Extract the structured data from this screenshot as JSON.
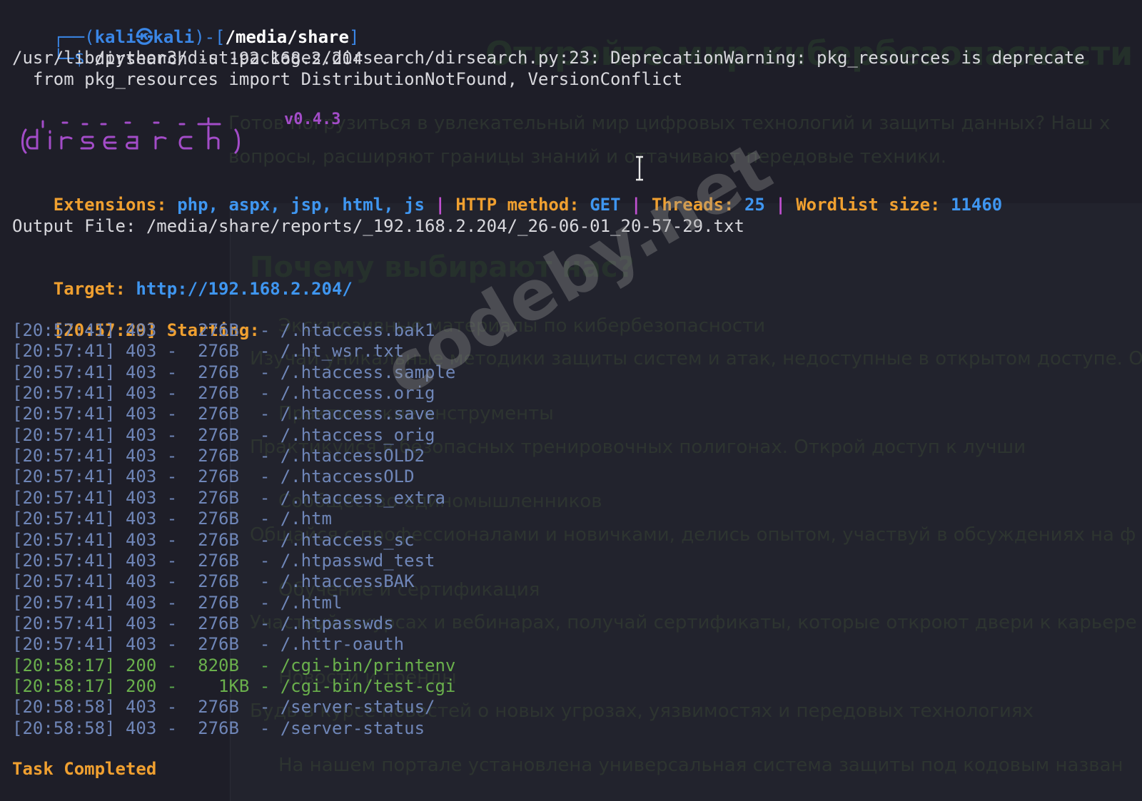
{
  "prompt": {
    "frame_top": "┌──(",
    "user": "kali㉿kali",
    "frame_mid": ")-[",
    "path": "/media/share",
    "frame_end": "]",
    "frame_bottom": "└─$",
    "command": " dirsearch -u 192.168.2.204"
  },
  "warning": {
    "line1": "/usr/lib/python3/dist-packages/dirsearch/dirsearch.py:23: DeprecationWarning: pkg_resources is deprecate",
    "line2": "  from pkg_resources import DistributionNotFound, VersionConflict"
  },
  "banner": {
    "version": "v0.4.3"
  },
  "config": {
    "ext_label": "Extensions:",
    "ext_value": "php, aspx, jsp, html, js",
    "sep": "|",
    "method_label": "HTTP method:",
    "method_value": "GET",
    "threads_label": "Threads:",
    "threads_value": "25",
    "wordlist_label": "Wordlist size:",
    "wordlist_value": "11460"
  },
  "output_file": "Output File: /media/share/reports/_192.168.2.204/_26-06-01_20-57-29.txt",
  "target": {
    "label": "Target:",
    "url": "http://192.168.2.204/"
  },
  "starting": {
    "ts": "[20:57:29]",
    "label": "Starting:"
  },
  "results": [
    {
      "ts": "[20:57:41]",
      "code": "403",
      "size": " 276B ",
      "path": "/.htaccess.bak1"
    },
    {
      "ts": "[20:57:41]",
      "code": "403",
      "size": " 276B ",
      "path": "/.ht_wsr.txt"
    },
    {
      "ts": "[20:57:41]",
      "code": "403",
      "size": " 276B ",
      "path": "/.htaccess.sample"
    },
    {
      "ts": "[20:57:41]",
      "code": "403",
      "size": " 276B ",
      "path": "/.htaccess.orig"
    },
    {
      "ts": "[20:57:41]",
      "code": "403",
      "size": " 276B ",
      "path": "/.htaccess.save"
    },
    {
      "ts": "[20:57:41]",
      "code": "403",
      "size": " 276B ",
      "path": "/.htaccess_orig"
    },
    {
      "ts": "[20:57:41]",
      "code": "403",
      "size": " 276B ",
      "path": "/.htaccessOLD2"
    },
    {
      "ts": "[20:57:41]",
      "code": "403",
      "size": " 276B ",
      "path": "/.htaccessOLD"
    },
    {
      "ts": "[20:57:41]",
      "code": "403",
      "size": " 276B ",
      "path": "/.htaccess_extra"
    },
    {
      "ts": "[20:57:41]",
      "code": "403",
      "size": " 276B ",
      "path": "/.htm"
    },
    {
      "ts": "[20:57:41]",
      "code": "403",
      "size": " 276B ",
      "path": "/.htaccess_sc"
    },
    {
      "ts": "[20:57:41]",
      "code": "403",
      "size": " 276B ",
      "path": "/.htpasswd_test"
    },
    {
      "ts": "[20:57:41]",
      "code": "403",
      "size": " 276B ",
      "path": "/.htaccessBAK"
    },
    {
      "ts": "[20:57:41]",
      "code": "403",
      "size": " 276B ",
      "path": "/.html"
    },
    {
      "ts": "[20:57:41]",
      "code": "403",
      "size": " 276B ",
      "path": "/.htpasswds"
    },
    {
      "ts": "[20:57:41]",
      "code": "403",
      "size": " 276B ",
      "path": "/.httr-oauth"
    },
    {
      "ts": "[20:58:17]",
      "code": "200",
      "size": " 820B ",
      "path": "/cgi-bin/printenv"
    },
    {
      "ts": "[20:58:17]",
      "code": "200",
      "size": "   1KB",
      "path": "/cgi-bin/test-cgi"
    },
    {
      "ts": "[20:58:58]",
      "code": "403",
      "size": " 276B ",
      "path": "/server-status/"
    },
    {
      "ts": "[20:58:58]",
      "code": "403",
      "size": " 276B ",
      "path": "/server-status"
    }
  ],
  "task_completed": "Task Completed",
  "watermark": "codeby.net",
  "background_page": {
    "heading": "Откройте мир кибербезопасности",
    "intro1": "Готов погрузиться в увлекательный мир цифровых технологий и защиты данных? Наш х",
    "intro2": "вопросы, расширяют границы знаний и оттачивают передовые техники.",
    "subheading": "Почему выбирают нас?",
    "features": [
      "Эксклюзивные материалы по кибербезопасности",
      "Изучай уникальные методики защиты систем и атак, недоступные в открытом доступе. О",
      "Практические инструменты",
      "Практикуйся в безопасных тренировочных полигонах. Открой доступ к лучши",
      "Сообщество единомышленников",
      "Общайся с профессионалами и новичками, делись опытом, участвуй в обсуждениях на ф",
      "Обучение и сертификация",
      "Участвуй в курсах и вебинарах, получай сертификаты, которые откроют двери к карьере",
      "Новости и тренды",
      "Будь в курсе новостей о новых угрозах, уязвимостях и передовых технологиях",
      "На нашем портале установлена универсальная система защиты под кодовым назван"
    ]
  },
  "colors": {
    "background": "#1e1e28",
    "prompt_blue": "#3a86e6",
    "orange": "#f0a030",
    "blue_value": "#3f96f0",
    "separator": "#c050d0",
    "status_403": "#6f86b8",
    "status_200": "#6ab04c",
    "banner_purple": "#a34cc8"
  }
}
